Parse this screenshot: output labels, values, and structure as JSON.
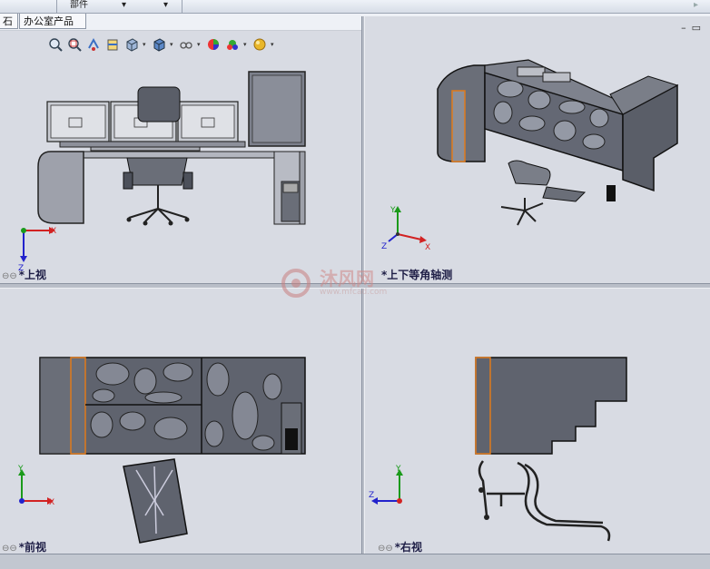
{
  "top_menu": {
    "parts_label": "部件"
  },
  "tabs": [
    {
      "label": "石"
    },
    {
      "label": "办公室产品"
    }
  ],
  "views": {
    "top": {
      "label": "*上视"
    },
    "iso": {
      "label": "*上下等角轴测"
    },
    "front": {
      "label": "*前视"
    },
    "right": {
      "label": "*右视"
    }
  },
  "toolbar_icons": [
    "zoom-fit-icon",
    "zoom-area-icon",
    "previous-view-icon",
    "section-view-icon",
    "view-orientation-icon",
    "display-style-icon",
    "hide-show-icon",
    "appearance-icon",
    "scene-icon",
    "render-icon"
  ],
  "axes": {
    "x": "X",
    "y": "Y",
    "z": "Z"
  },
  "watermark": {
    "title": "沐风网",
    "sub": "www.mfcad.com"
  },
  "colors": {
    "viewport_bg": "#d8dbe3",
    "model_gray": "#6e7282",
    "edge_orange": "#e07a1a",
    "axis_x": "#d22222",
    "axis_y": "#1a9a1a",
    "axis_z": "#2222cc"
  }
}
